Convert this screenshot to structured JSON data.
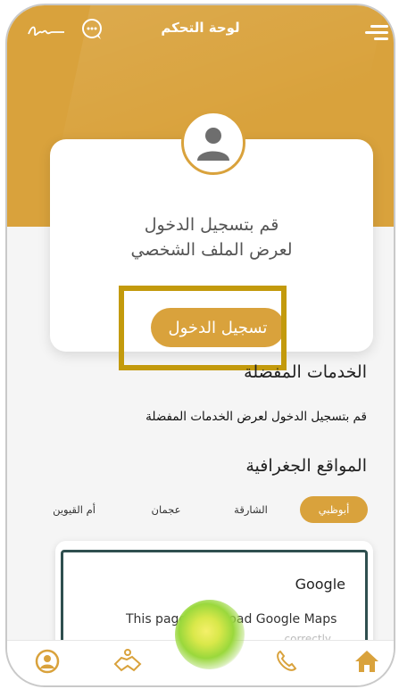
{
  "header": {
    "title": "لوحة التحكم"
  },
  "profile_card": {
    "message_line1": "قم بتسجيل الدخول",
    "message_line2": "لعرض الملف الشخصي",
    "login_button": "تسجيل الدخول"
  },
  "favorites": {
    "title": "الخدمات المفضلة",
    "message": "قم بتسجيل الدخول لعرض الخدمات المفضلة"
  },
  "geo": {
    "title": "المواقع الجغرافية",
    "tabs": [
      {
        "label": "أبوظبي",
        "active": true
      },
      {
        "label": "الشارقة",
        "active": false
      },
      {
        "label": "عجمان",
        "active": false
      },
      {
        "label": "أم القيوين",
        "active": false
      }
    ]
  },
  "map": {
    "brand": "Google",
    "message": "This page can't load Google Maps",
    "message2": "correctly"
  },
  "colors": {
    "accent": "#d9a23c",
    "highlight": "#c39a0c"
  },
  "bottom_nav": [
    "profile-icon",
    "handshake-icon",
    "phone-icon",
    "home-icon"
  ]
}
